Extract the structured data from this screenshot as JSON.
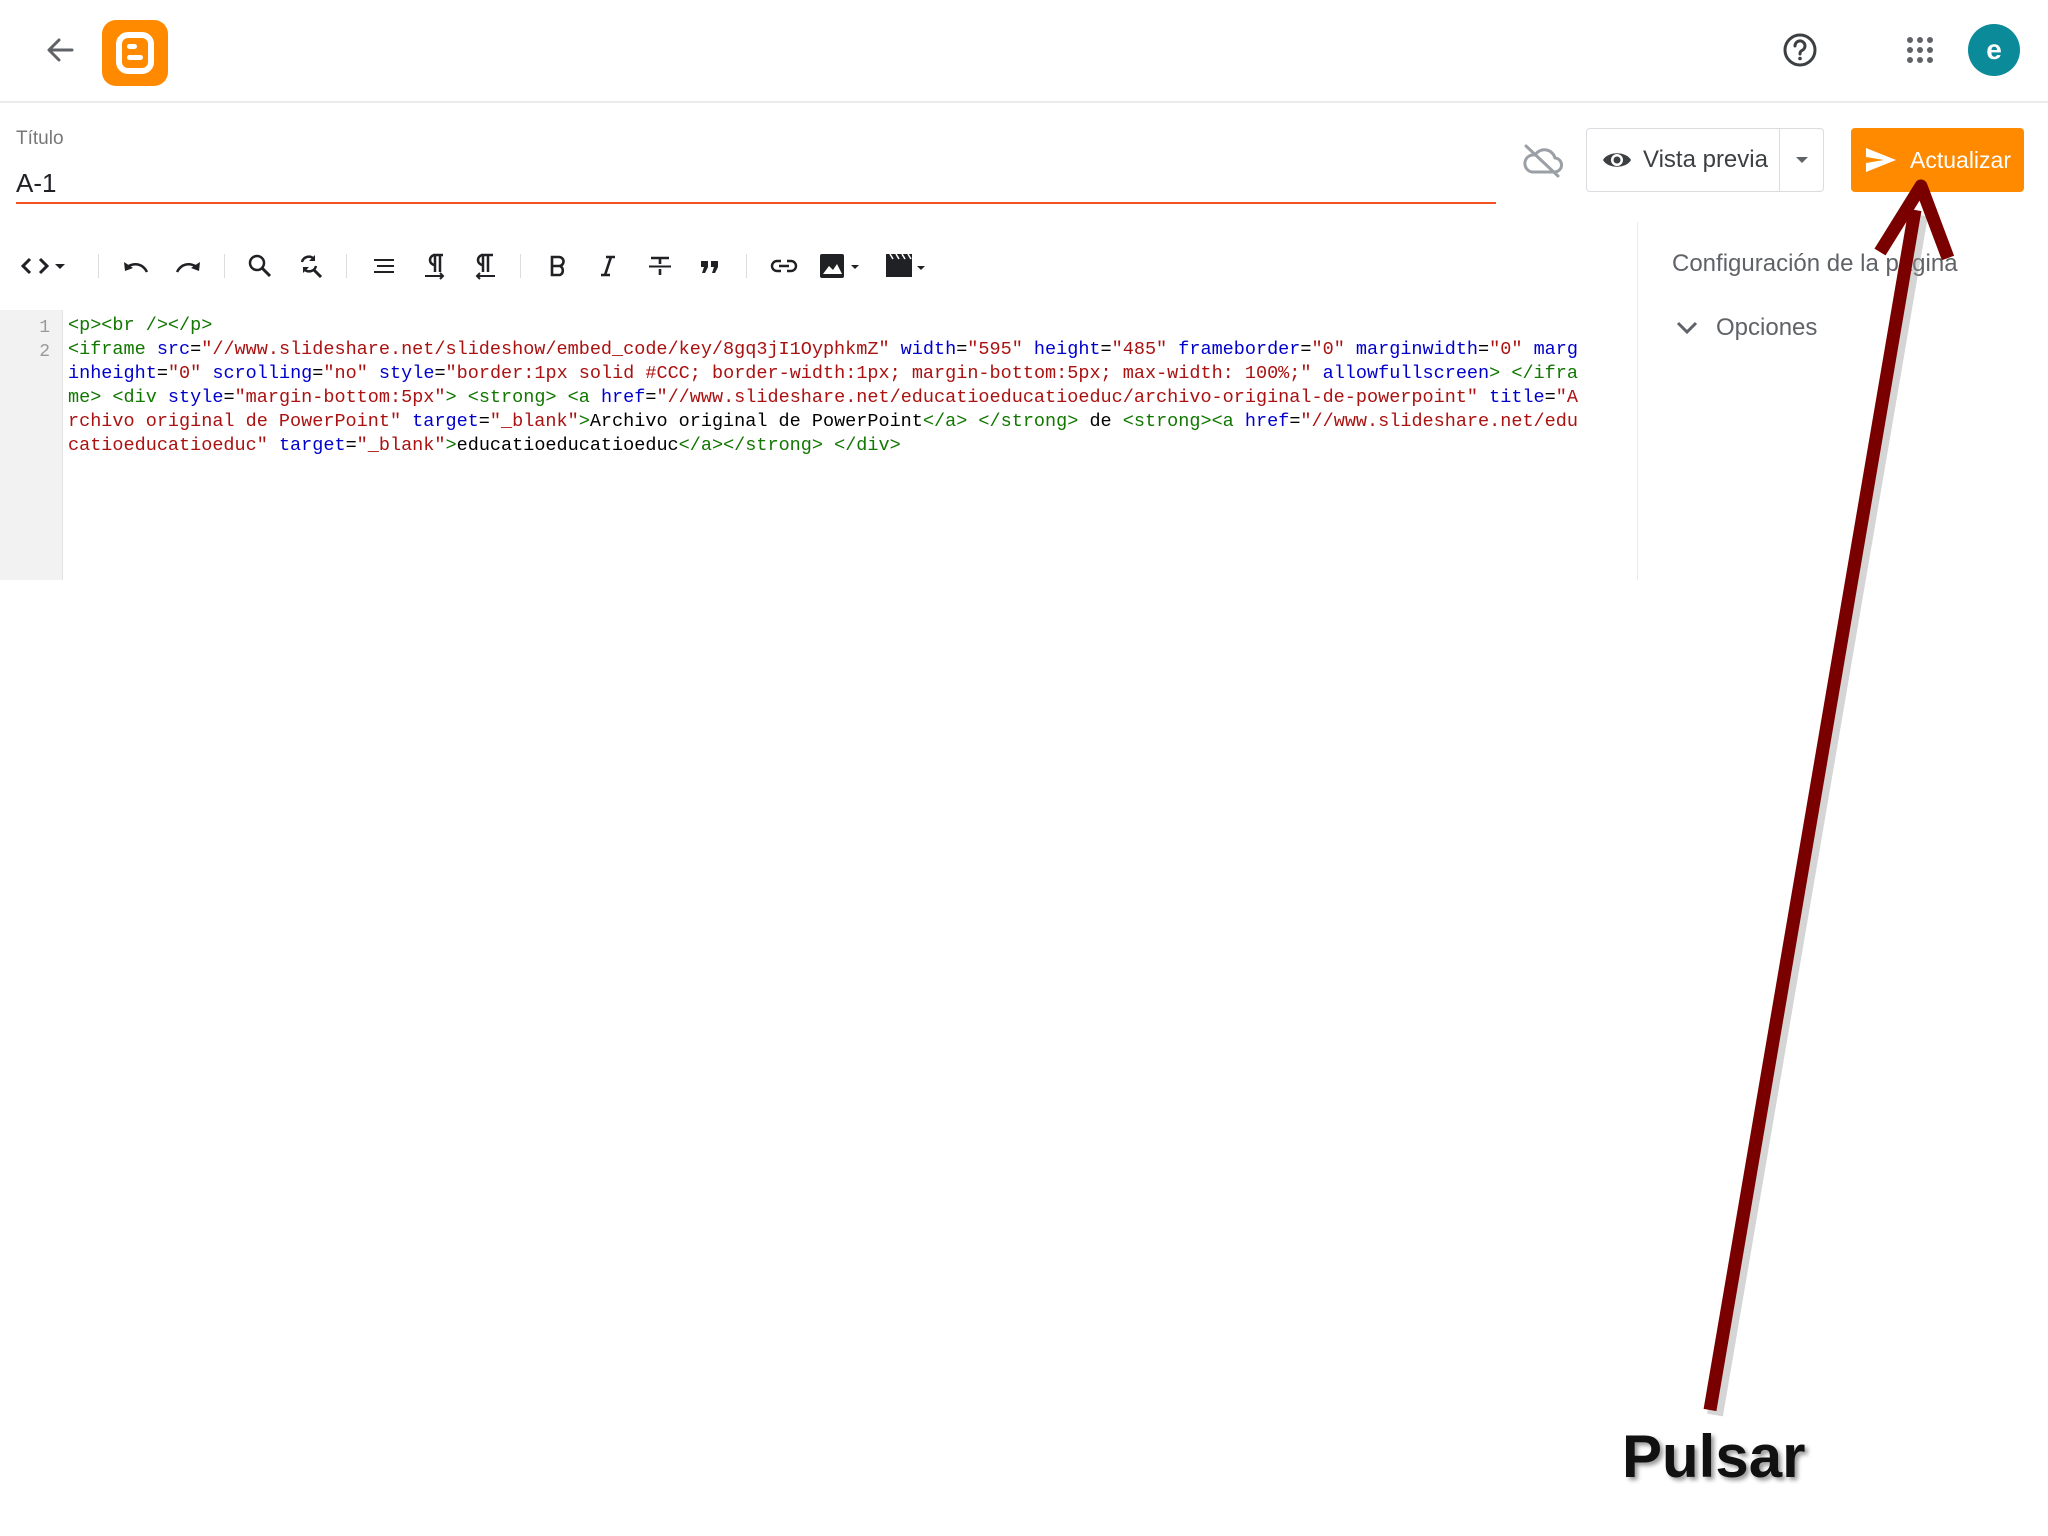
{
  "title_field": {
    "label": "Título",
    "value": "A-1"
  },
  "actions": {
    "preview_label": "Vista previa",
    "update_label": "Actualizar"
  },
  "avatar": {
    "initial": "e"
  },
  "editor": {
    "line_numbers": [
      "1",
      "2"
    ],
    "line1": "<p><br /></p>",
    "line2": {
      "seg01": "<iframe",
      "seg02": " src",
      "seg03": "=",
      "seg04": "\"//www.slideshare.net/slideshow/embed_code/key/8gq3jI1OyphkmZ\"",
      "seg05": " width",
      "seg06": "=",
      "seg07": "\"595\"",
      "seg08": " height",
      "seg09": "=",
      "seg10": "\"485\"",
      "seg11": " frameborder",
      "seg12": "=",
      "seg13": "\"0\"",
      "seg14": " marginwidth",
      "seg15": "=",
      "seg16": "\"0\"",
      "seg17": " marginheight",
      "seg18": "=",
      "seg19": "\"0\"",
      "seg20": " scrolling",
      "seg21": "=",
      "seg22": "\"no\"",
      "seg23": " style",
      "seg24": "=",
      "seg25": "\"border:1px solid #CCC; border-width:1px; margin-bottom:5px; max-width: 100%;\"",
      "seg26": " allowfullscreen",
      "seg27": ">",
      "seg28": " </iframe>",
      "seg29": " <div",
      "seg30": " style",
      "seg31": "=",
      "seg32": "\"margin-bottom:5px\"",
      "seg33": ">",
      "seg34": " <strong>",
      "seg35": " <a",
      "seg36": " href",
      "seg37": "=",
      "seg38": "\"//www.slideshare.net/educatioeducatioeduc/archivo-original-de-powerpoint\"",
      "seg39": " title",
      "seg40": "=",
      "seg41": "\"Archivo original de PowerPoint\"",
      "seg42": " target",
      "seg43": "=",
      "seg44": "\"_blank\"",
      "seg45": ">",
      "seg46": "Archivo original de PowerPoint",
      "seg47": "</a>",
      "seg48": " </strong>",
      "seg49": " de ",
      "seg50": "<strong><a",
      "seg51": " href",
      "seg52": "=",
      "seg53": "\"//www.slideshare.net/educatioeducatioeduc\"",
      "seg54": " target",
      "seg55": "=",
      "seg56": "\"_blank\"",
      "seg57": ">",
      "seg58": "educatioeducatioeduc",
      "seg59": "</a></strong>",
      "seg60": " </div>"
    }
  },
  "side_panel": {
    "title": "Configuración de la página",
    "options_label": "Opciones"
  },
  "annotation": {
    "text": "Pulsar",
    "color": "#7a0000"
  },
  "colors": {
    "brand": "#ff8a00",
    "accent_underline": "#f4511e",
    "avatar": "#0b8a99"
  }
}
